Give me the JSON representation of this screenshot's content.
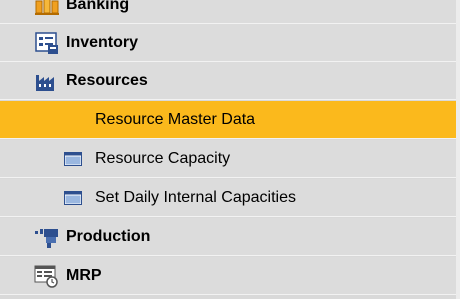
{
  "menu": {
    "items": [
      {
        "label": "Banking",
        "icon": "banking-icon",
        "level": 1
      },
      {
        "label": "Inventory",
        "icon": "inventory-icon",
        "level": 1
      },
      {
        "label": "Resources",
        "icon": "resources-factory-icon",
        "level": 1
      },
      {
        "label": "Resource Master Data",
        "icon": "",
        "level": 2,
        "selected": true
      },
      {
        "label": "Resource Capacity",
        "icon": "window-icon",
        "level": 2
      },
      {
        "label": "Set Daily Internal Capacities",
        "icon": "window-icon",
        "level": 2
      },
      {
        "label": "Production",
        "icon": "production-icon",
        "level": 1
      },
      {
        "label": "MRP",
        "icon": "mrp-icon",
        "level": 1
      }
    ]
  },
  "colors": {
    "background": "#dcdcdc",
    "selected": "#fbb91c",
    "separator": "#f2f2f2",
    "icon_blue": "#2d4f8f",
    "icon_orange": "#f0a020"
  }
}
